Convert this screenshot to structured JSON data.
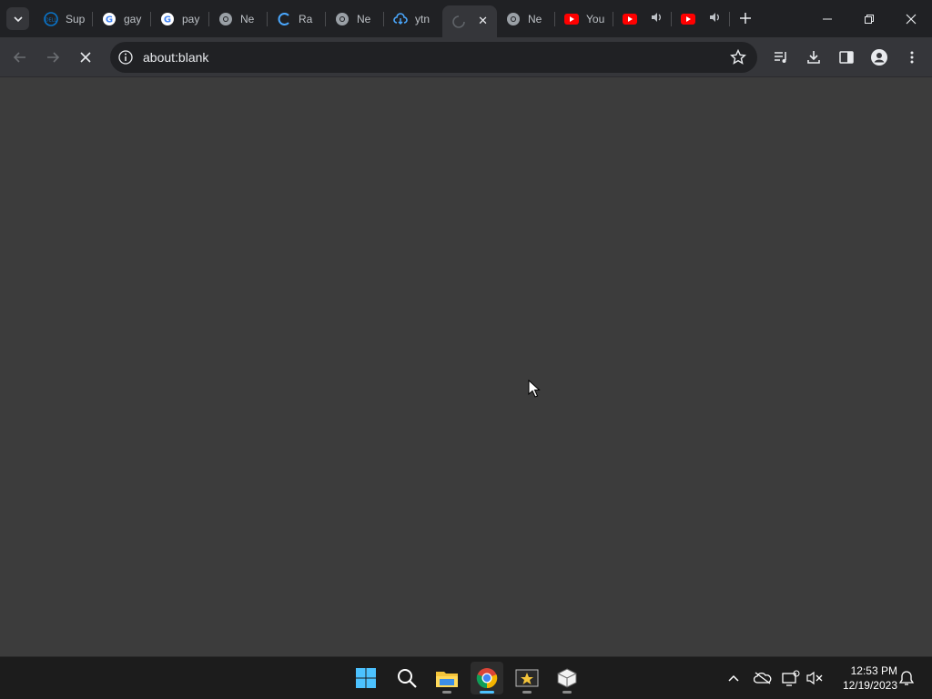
{
  "browser": {
    "tabs": [
      {
        "title": "Sup",
        "icon": "dell-icon"
      },
      {
        "title": "gay",
        "icon": "google-icon"
      },
      {
        "title": "pay",
        "icon": "google-icon"
      },
      {
        "title": "Ne",
        "icon": "chrome-icon"
      },
      {
        "title": "Ra",
        "icon": "rainbow-icon"
      },
      {
        "title": "Ne",
        "icon": "chrome-icon"
      },
      {
        "title": "ytn",
        "icon": "cloud-icon"
      },
      {
        "title": "",
        "icon": "loading-spinner-icon",
        "active": true
      },
      {
        "title": "Ne",
        "icon": "chrome-icon"
      },
      {
        "title": "You",
        "icon": "youtube-icon"
      },
      {
        "title": "",
        "icon": "youtube-icon",
        "audio": true
      },
      {
        "title": "",
        "icon": "youtube-icon",
        "audio": true
      }
    ],
    "address": "about:blank"
  },
  "taskbar": {
    "time": "12:53 PM",
    "date": "12/19/2023"
  },
  "colors": {
    "accent": "#4cc2ff",
    "youtube": "#ff0000",
    "page_bg": "#3c3c3c"
  }
}
